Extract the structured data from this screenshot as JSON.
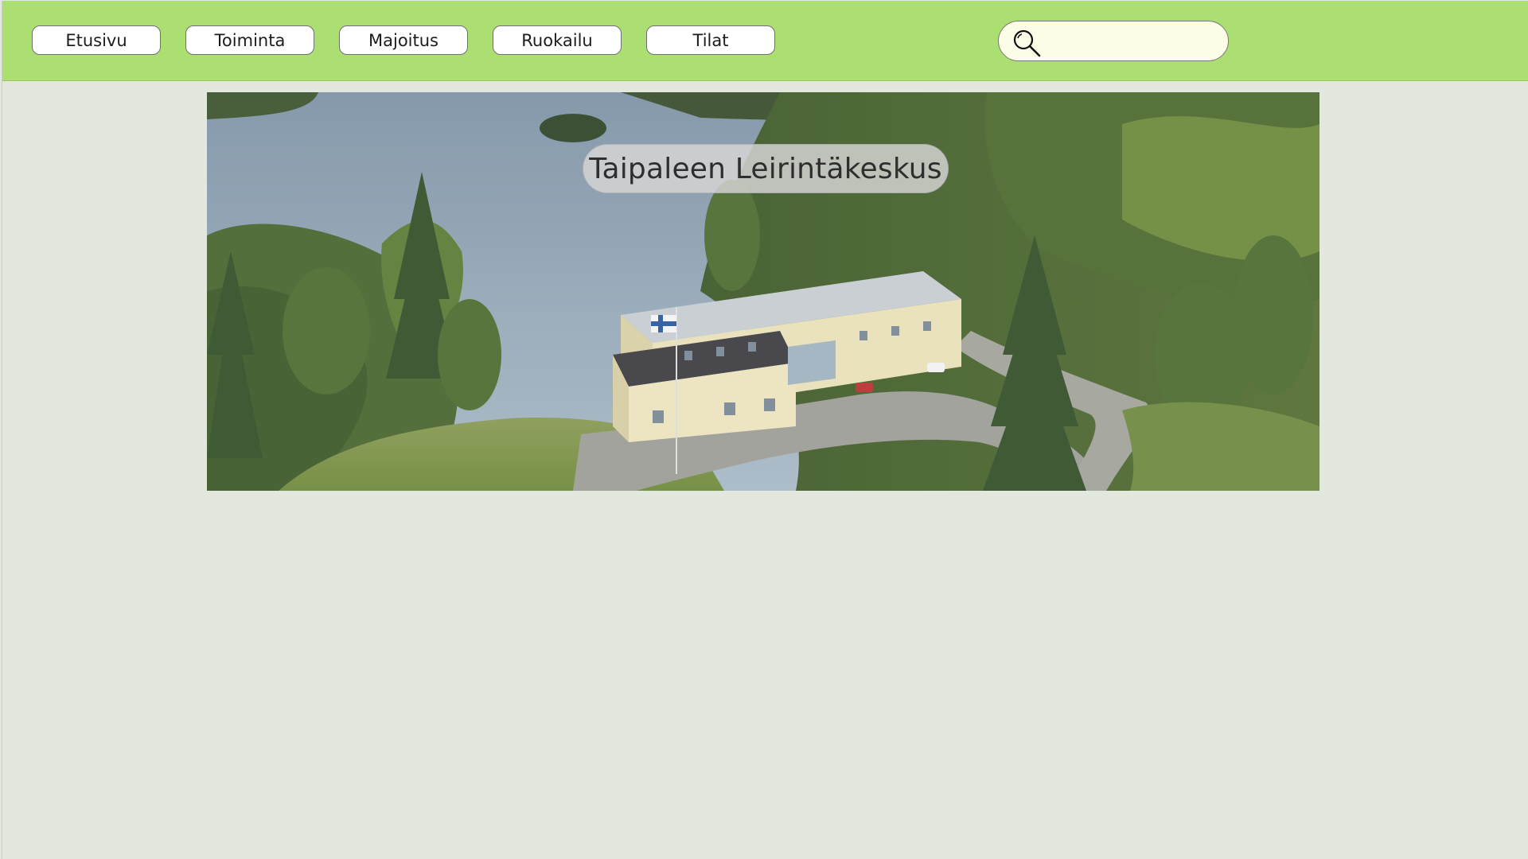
{
  "nav": {
    "items": [
      {
        "label": "Etusivu"
      },
      {
        "label": "Toiminta"
      },
      {
        "label": "Majoitus"
      },
      {
        "label": "Ruokailu"
      },
      {
        "label": "Tilat"
      }
    ]
  },
  "search": {
    "icon": "search-icon",
    "value": "",
    "placeholder": ""
  },
  "hero": {
    "title": "Taipaleen Leirintäkeskus"
  },
  "colors": {
    "topbar": "#acdf72",
    "background": "#e2e8de",
    "search_field": "#fefde8"
  }
}
